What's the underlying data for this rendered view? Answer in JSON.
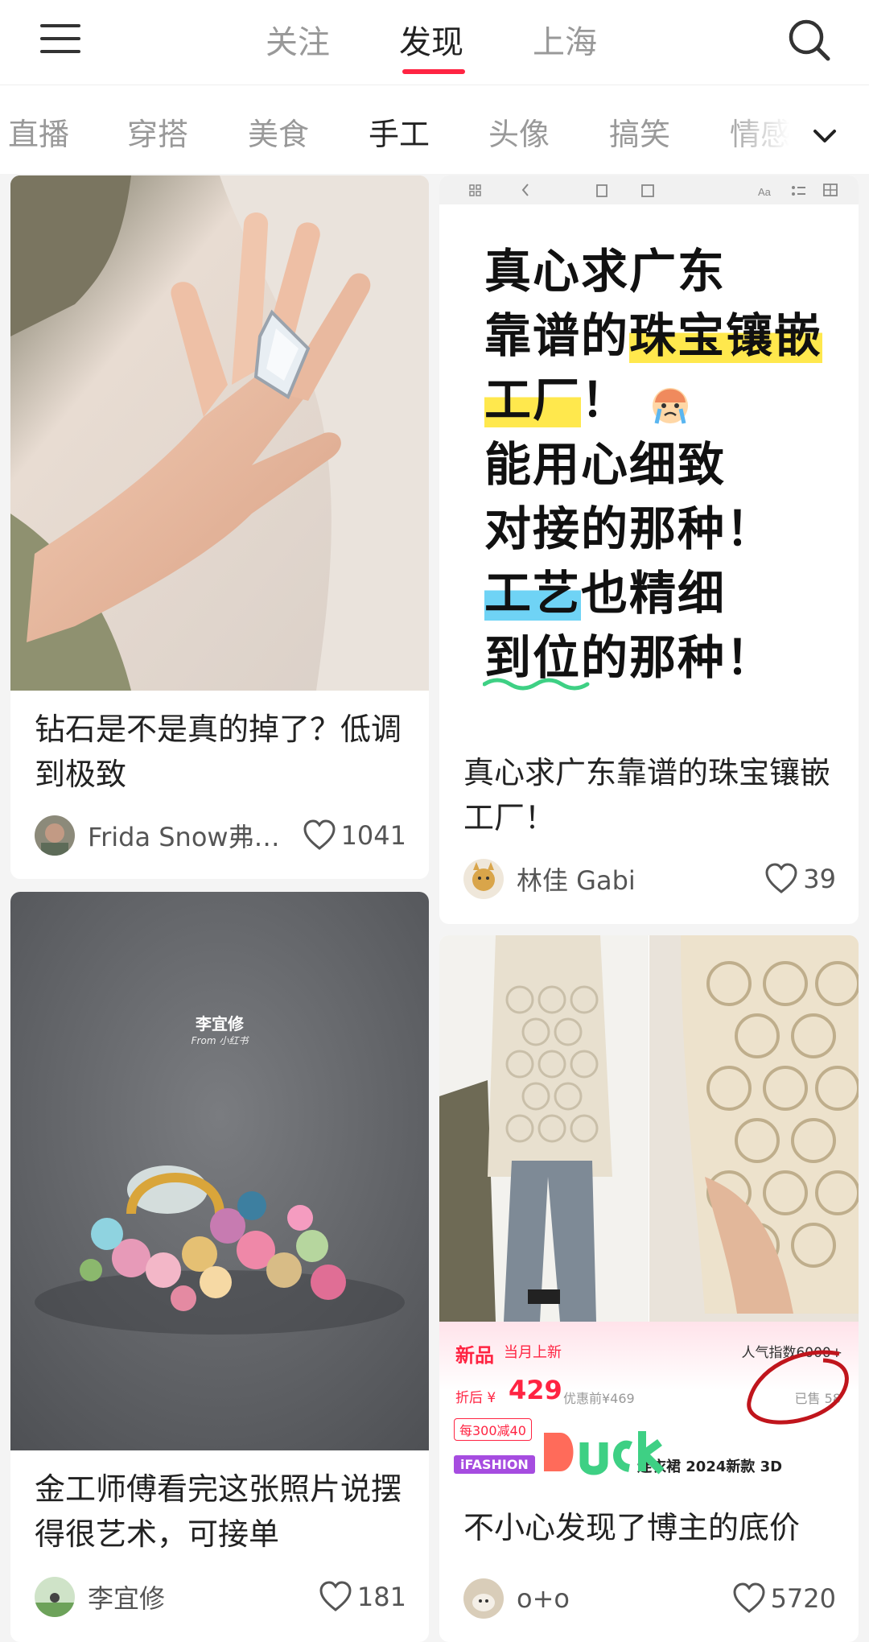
{
  "header": {
    "tabs": [
      "关注",
      "发现",
      "上海"
    ],
    "active_tab": "发现"
  },
  "categories": {
    "items": [
      "直播",
      "穿搭",
      "美食",
      "手工",
      "头像",
      "搞笑",
      "情感"
    ],
    "active": "手工"
  },
  "colors": {
    "accent": "#ff2442",
    "highlight_yellow": "#ffe84d",
    "highlight_blue": "#6fd3f5",
    "price_red": "#ff2442"
  },
  "icons": [
    "menu-icon",
    "search-icon",
    "chevron-down-icon",
    "heart-icon"
  ],
  "feed": {
    "card1": {
      "title": "钻石是不是真的掉了？低调到极致",
      "author": "Frida Snow弗…",
      "likes": "1041"
    },
    "card2": {
      "note_lines": [
        "真心求广东",
        "靠谱的",
        "珠宝镶嵌",
        "工厂",
        "！",
        "能用心细致",
        "对接的那种！",
        "工艺",
        "也精细",
        "到位",
        "的那种！"
      ],
      "title": "真心求广东靠谱的珠宝镶嵌工厂！",
      "author": "林佳 Gabi",
      "likes": "39"
    },
    "card3": {
      "watermark_name": "李宜修",
      "watermark_from": "From 小红书",
      "title": "金工师傅看完这张照片说摆得很艺术，可接单",
      "author": "李宜修",
      "likes": "181"
    },
    "card4": {
      "banner_new": "新品",
      "banner_month": "当月上新",
      "popularity": "人气指数6000+",
      "price_prefix": "折后 ¥",
      "price": "429",
      "price_before": "优惠前¥469",
      "sold": "已售 58",
      "discount": "每300减40",
      "ifashion": "iFASHION",
      "product": "连衣裙 2024新款 3D",
      "title": "不小心发现了博主的底价",
      "author": "o+o",
      "likes": "5720"
    }
  }
}
